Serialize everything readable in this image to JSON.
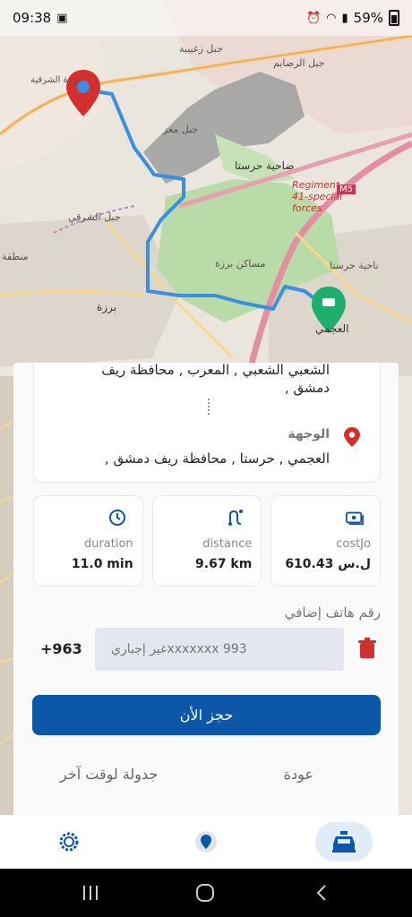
{
  "status_bar": {
    "time": "09:38",
    "battery": "59%"
  },
  "map": {
    "labels": {
      "jabal_zaghibiya": "جبل زغيبية",
      "jabal_dayamis": "جبل الرضايم",
      "jabal_maaz": "جبل معز",
      "harasta": "ضاحية حرستا",
      "regiment": "Regiment 41-special forces",
      "m5": "M5",
      "jabal_sharqi": "جبل الشرقي",
      "barzeh_heights": "مساكن برزة",
      "barzeh": "برزة",
      "harasta_area": "ناحية حرستا",
      "ajami": "العجمي",
      "area_industrial": "منطقة",
      "sharqiya": "برزة الشرقية"
    }
  },
  "route": {
    "origin_text": "الشعبي الشعبي , المعرب , محافظة ريف دمشق ,",
    "destination_label": "الوجهة",
    "destination_text": "العجمي , حرستا , محافظة ريف دمشق ,"
  },
  "stats": {
    "cost_label": "costJo",
    "cost_value": "610.43 ل.س",
    "distance_label": "distance",
    "distance_value": "9.67 km",
    "duration_label": "duration",
    "duration_value": "11.0 min"
  },
  "phone": {
    "label": "رقم هاتف إضافي",
    "placeholder": "993 xxxxxxxغير إجباري",
    "prefix": "+963"
  },
  "actions": {
    "book_now": "حجز الأن",
    "schedule_later": "جدولة لوقت آخر",
    "back": "عودة"
  },
  "colors": {
    "primary": "#0d57a8",
    "route_line": "#3b8fe0",
    "origin_pin": "#d32f2f",
    "destination_pin": "#1fae6b",
    "map_park": "#b9dba8"
  }
}
